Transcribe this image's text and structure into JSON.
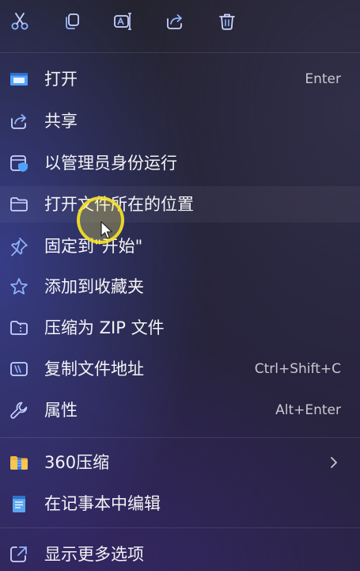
{
  "toolbar": {
    "buttons": [
      {
        "icon": "scissors-icon",
        "action": "cut"
      },
      {
        "icon": "copy-icon",
        "action": "copy"
      },
      {
        "icon": "rename-icon",
        "action": "rename"
      },
      {
        "icon": "share-icon",
        "action": "share"
      },
      {
        "icon": "trash-icon",
        "action": "delete"
      }
    ]
  },
  "menu": {
    "items": [
      {
        "label": "打开",
        "shortcut": "Enter",
        "icon": "open-window-icon"
      },
      {
        "label": "共享",
        "shortcut": "",
        "icon": "share-icon"
      },
      {
        "label": "以管理员身份运行",
        "shortcut": "",
        "icon": "shield-window-icon"
      },
      {
        "label": "打开文件所在的位置",
        "shortcut": "",
        "icon": "folder-icon"
      },
      {
        "label": "固定到\"开始\"",
        "shortcut": "",
        "icon": "pin-icon"
      },
      {
        "label": "添加到收藏夹",
        "shortcut": "",
        "icon": "star-icon"
      },
      {
        "label": "压缩为 ZIP 文件",
        "shortcut": "",
        "icon": "zip-folder-icon"
      },
      {
        "label": "复制文件地址",
        "shortcut": "Ctrl+Shift+C",
        "icon": "copy-path-icon"
      },
      {
        "label": "属性",
        "shortcut": "Alt+Enter",
        "icon": "wrench-icon"
      }
    ],
    "extra_items": [
      {
        "label": "360压缩",
        "icon": "360-zip-icon",
        "has_submenu": true
      },
      {
        "label": "在记事本中编辑",
        "icon": "notepad-icon"
      }
    ],
    "more_options": {
      "label": "显示更多选项",
      "icon": "more-options-icon"
    }
  },
  "colors": {
    "accent_blue": "#4fa3ff",
    "icon_outline": "#b8c6ff",
    "cursor_highlight": "#f5e228"
  }
}
